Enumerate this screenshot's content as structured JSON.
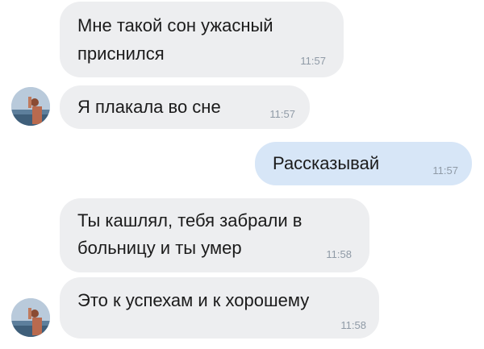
{
  "messages": [
    {
      "direction": "incoming",
      "lines": [
        "Мне такой сон ужасный",
        "приснился"
      ],
      "time": "11:57"
    },
    {
      "direction": "incoming",
      "lines": [
        "Я плакала во сне"
      ],
      "time": "11:57"
    },
    {
      "direction": "outgoing",
      "lines": [
        "Рассказывай"
      ],
      "time": "11:57"
    },
    {
      "direction": "incoming",
      "lines": [
        "Ты кашлял, тебя забрали в",
        "больницу и ты умер"
      ],
      "time": "11:58"
    },
    {
      "direction": "incoming",
      "lines": [
        "Это к успехам и к хорошему"
      ],
      "time": "11:58"
    }
  ],
  "avatars": [
    {
      "icon": "user-photo-avatar"
    },
    {
      "icon": "user-photo-avatar"
    }
  ],
  "colors": {
    "incoming_bubble": "#edeef0",
    "outgoing_bubble": "#d7e6f7",
    "timestamp": "#8f9aa6",
    "text": "#1b1b1b"
  }
}
